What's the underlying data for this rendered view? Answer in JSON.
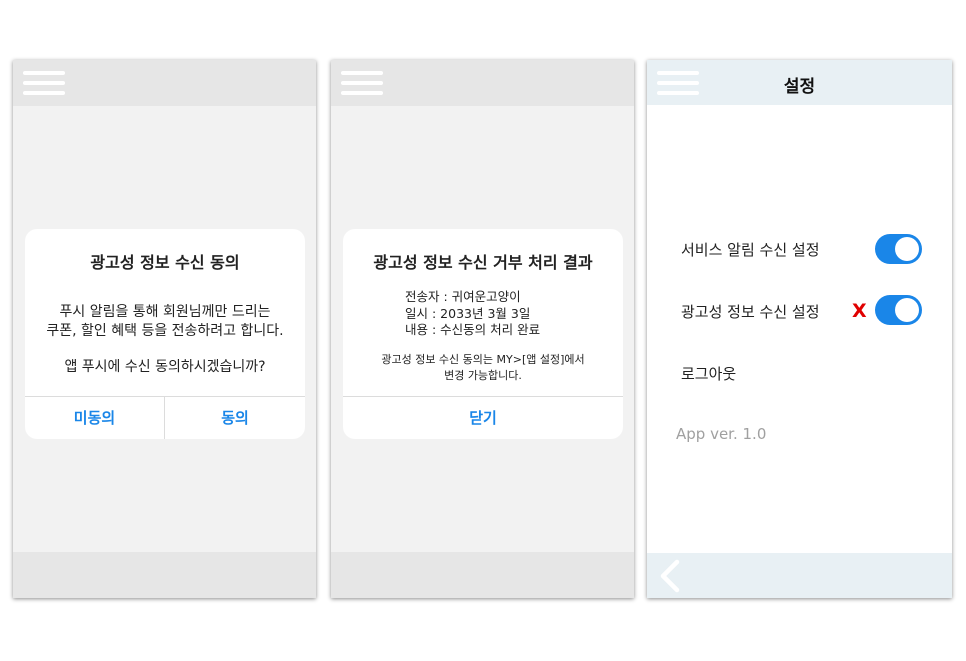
{
  "screen1": {
    "dialog": {
      "title": "광고성 정보 수신 동의",
      "body_line1": "푸시 알림을 통해 회원님께만 드리는",
      "body_line2": "쿠폰, 할인 혜택 등을 전송하려고 합니다.",
      "question": "앱 푸시에 수신 동의하시겠습니까?",
      "decline_label": "미동의",
      "agree_label": "동의"
    }
  },
  "screen2": {
    "dialog": {
      "title": "광고성 정보 수신 거부 처리 결과",
      "sender": "전송자 : 귀여운고양이",
      "date": "일시 : 2033년 3월 3일",
      "content": "내용 : 수신동의 처리 완료",
      "note_line1": "광고성 정보 수신 동의는 MY>[앱 설정]에서",
      "note_line2": "변경 가능합니다.",
      "close_label": "닫기"
    }
  },
  "screen3": {
    "title": "설정",
    "service_alert_label": "서비스 알림 수신 설정",
    "ad_info_label": "광고성 정보 수신 설정",
    "ad_info_mark": "X",
    "logout_label": "로그아웃",
    "version_label": "App ver. 1.0",
    "toggles": {
      "service_alert_on": true,
      "ad_info_on": true,
      "color": "#1a86e8"
    }
  },
  "colors": {
    "accent": "#1a86e8",
    "warning": "#e00000"
  },
  "icons": {
    "menu": "hamburger-menu-icon",
    "back": "chevron-left-icon"
  }
}
